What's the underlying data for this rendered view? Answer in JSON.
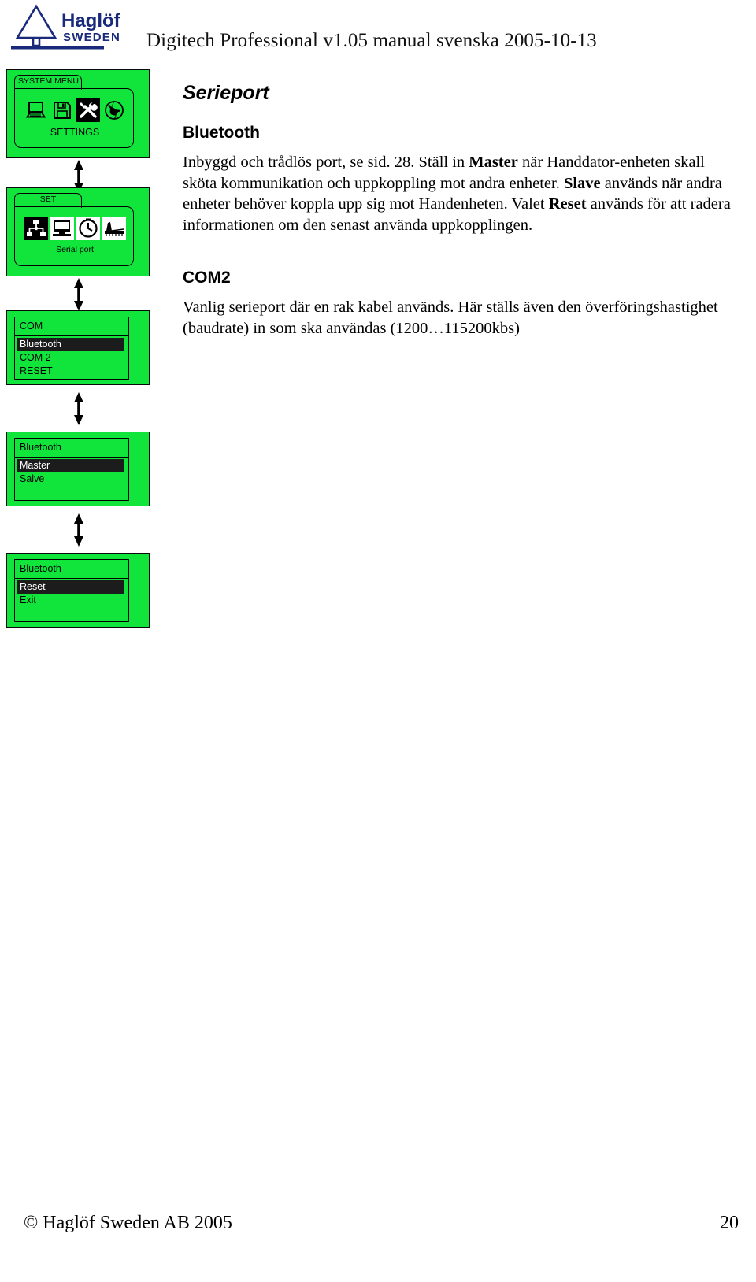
{
  "header": {
    "logo_name": "Haglöf",
    "logo_sub": "SWEDEN",
    "doc_title": "Digitech Professional v1.05 manual svenska 2005-10-13"
  },
  "screens": [
    {
      "kind": "folder",
      "tab_label": "SYSTEM MENU",
      "caption": "SETTINGS",
      "icons": [
        {
          "name": "computer-icon",
          "selected": false
        },
        {
          "name": "floppy-disk-icon",
          "selected": false
        },
        {
          "name": "tools-icon",
          "selected": true
        },
        {
          "name": "globe-icon",
          "selected": false
        }
      ]
    },
    {
      "kind": "folder",
      "tab_label": "SET",
      "caption": "Serial port",
      "icons": [
        {
          "name": "network-port-icon",
          "selected": true
        },
        {
          "name": "monitor-icon",
          "selected": false
        },
        {
          "name": "clock-icon",
          "selected": false
        },
        {
          "name": "chart-ruler-icon",
          "selected": false
        }
      ]
    },
    {
      "kind": "list",
      "title": "COM",
      "items": [
        {
          "label": "Bluetooth",
          "selected": true
        },
        {
          "label": "COM 2",
          "selected": false
        },
        {
          "label": "RESET",
          "selected": false
        }
      ]
    },
    {
      "kind": "list",
      "title": "Bluetooth",
      "items": [
        {
          "label": "Master",
          "selected": true
        },
        {
          "label": "Salve",
          "selected": false
        }
      ]
    },
    {
      "kind": "list",
      "title": "Bluetooth",
      "items": [
        {
          "label": "Reset",
          "selected": true
        },
        {
          "label": "Exit",
          "selected": false
        }
      ]
    }
  ],
  "content": {
    "heading": "Serieport",
    "bluetooth": {
      "subheading": "Bluetooth",
      "p1_a": "Inbyggd och trådlös port, se sid. 28. Ställ in ",
      "p1_b_master": "Master",
      "p1_c": " när Handdator-enheten skall sköta kommunikation och uppkoppling mot andra enheter. ",
      "p1_b_slave": "Slave",
      "p1_d": " används när andra enheter behöver koppla upp sig mot Handenheten. Valet ",
      "p1_b_reset": "Reset",
      "p1_e": " används för att radera informationen om den senast använda uppkopplingen."
    },
    "com2": {
      "subheading": "COM2",
      "p1": "Vanlig serieport där en rak kabel används. Här ställs även den överföringshastighet (baudrate) in som ska användas (1200…115200kbs)"
    }
  },
  "footer": {
    "copyright": "© Haglöf Sweden AB 2005",
    "page_number": "20"
  },
  "colors": {
    "lcd_green": "#11E43A",
    "logo_navy": "#1a2a7a",
    "selection_black": "#1c1c1c"
  }
}
